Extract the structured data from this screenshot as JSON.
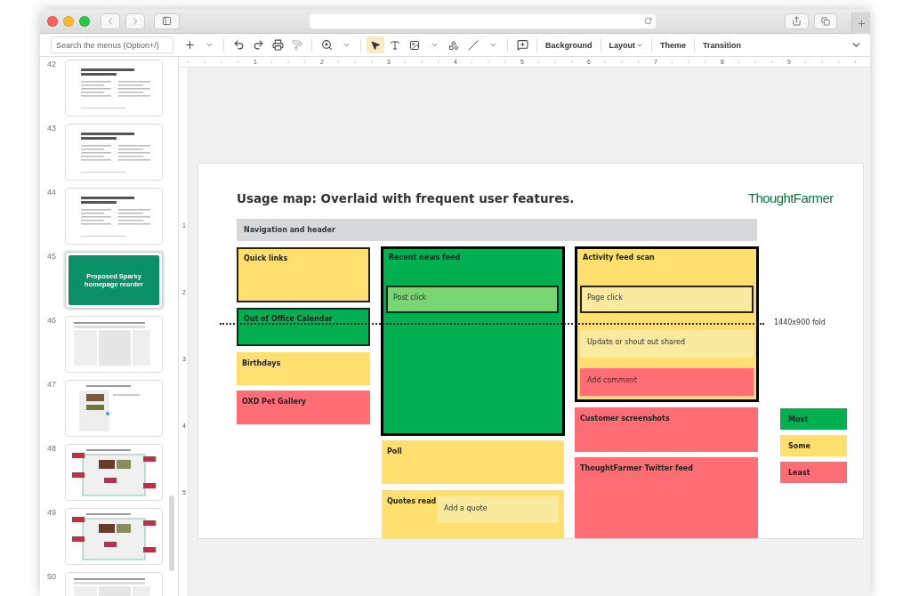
{
  "toolbar": {
    "search": {
      "placeholder": "Search the menus (Option+/)"
    },
    "tools": [
      {
        "kind": "select",
        "selected": true
      }
    ],
    "buttons": [
      {
        "label": "Background",
        "caret": false
      },
      {
        "label": "Layout",
        "caret": true
      },
      {
        "label": "Theme",
        "caret": false
      },
      {
        "label": "Transition",
        "caret": false
      }
    ]
  },
  "ruler": {
    "horizontal": [
      "1",
      "2",
      "3",
      "4",
      "5",
      "6",
      "7",
      "8",
      "9"
    ],
    "vertical": [
      "1",
      "2",
      "3",
      "4",
      "5"
    ]
  },
  "slides": [
    {
      "number": "42",
      "selected": false,
      "kind": "text"
    },
    {
      "number": "43",
      "selected": false,
      "kind": "text"
    },
    {
      "number": "44",
      "selected": false,
      "kind": "text"
    },
    {
      "number": "45",
      "selected": true,
      "kind": "title",
      "title": "Proposed Sparky homepage reorder"
    },
    {
      "number": "46",
      "selected": false,
      "kind": "grid"
    },
    {
      "number": "47",
      "selected": false,
      "kind": "screenshot"
    },
    {
      "number": "48",
      "selected": false,
      "kind": "annotated"
    },
    {
      "number": "49",
      "selected": false,
      "kind": "annotated"
    },
    {
      "number": "50",
      "selected": false,
      "kind": "grid"
    }
  ],
  "slide": {
    "title": "Usage map: Overlaid with frequent user features.",
    "logo": "ThoughtFarmer",
    "header": {
      "label": "Navigation and header"
    },
    "fold": {
      "label": "1440x900 fold"
    },
    "blocks": [
      {
        "label": "Quick links",
        "color": "#ffe06e",
        "outlined": true,
        "highlighted": false
      },
      {
        "label": "Out of Office Calendar",
        "color": "#00b050",
        "outlined": true,
        "highlighted": false
      },
      {
        "label": "Birthdays",
        "color": "#ffe06e",
        "outlined": false,
        "highlighted": false
      },
      {
        "label": "OXD Pet Gallery",
        "color": "#ff6d75",
        "outlined": false,
        "highlighted": false
      },
      {
        "label": "Recent news feed",
        "color": "#00b050",
        "outlined": true,
        "highlighted": true,
        "children": [
          {
            "label": "Post click",
            "color": "#77d672",
            "outlined": true
          }
        ]
      },
      {
        "label": "Poll",
        "color": "#ffe06e",
        "outlined": false,
        "highlighted": false
      },
      {
        "label": "Quotes read",
        "color": "#ffe06e",
        "outlined": false,
        "highlighted": false,
        "children": [
          {
            "label": "Add a quote",
            "color": "#f9eaa0",
            "outlined": false
          }
        ]
      },
      {
        "label": "Activity feed scan",
        "color": "#ffe06e",
        "outlined": true,
        "highlighted": true,
        "children": [
          {
            "label": "Page click",
            "color": "#f9eaa0",
            "outlined": true
          },
          {
            "label": "Update or shout out shared",
            "color": "#f9eaa0",
            "outlined": false
          },
          {
            "label": "Add comment",
            "color": "#ff6d75",
            "outlined": false
          }
        ]
      },
      {
        "label": "Customer screenshots",
        "color": "#ff6d75",
        "outlined": false,
        "highlighted": false
      },
      {
        "label": "ThoughtFarmer Twitter feed",
        "color": "#ff6d75",
        "outlined": false,
        "highlighted": false
      }
    ],
    "legend": [
      {
        "label": "Most",
        "color": "#00b050"
      },
      {
        "label": "Some",
        "color": "#ffe06e"
      },
      {
        "label": "Least",
        "color": "#ff6d75"
      }
    ]
  }
}
